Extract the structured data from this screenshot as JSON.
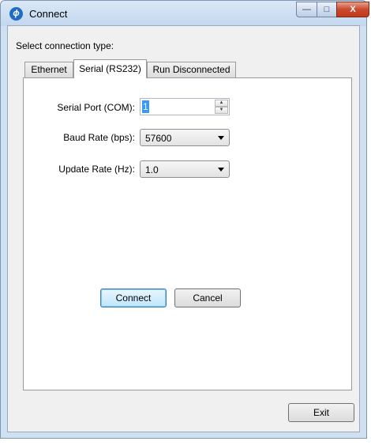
{
  "window": {
    "title": "Connect",
    "app_icon_glyph": "ϕ",
    "controls": {
      "minimize": "—",
      "maximize": "□",
      "close": "X"
    }
  },
  "dialog": {
    "prompt": "Select connection type:",
    "tabs": [
      {
        "label": "Ethernet",
        "selected": false
      },
      {
        "label": "Serial (RS232)",
        "selected": true
      },
      {
        "label": "Run Disconnected",
        "selected": false
      }
    ],
    "serial": {
      "serial_port": {
        "label": "Serial Port (COM):",
        "value": "1"
      },
      "baud_rate": {
        "label": "Baud Rate (bps):",
        "value": "57600"
      },
      "update_rate": {
        "label": "Update Rate (Hz):",
        "value": "1.0"
      },
      "connect_label": "Connect",
      "cancel_label": "Cancel"
    },
    "exit_label": "Exit"
  },
  "icons": {
    "app": "app-logo-icon",
    "spin_up": "▲",
    "spin_down": "▼"
  },
  "colors": {
    "title_bar": "#c2d7ee",
    "selection": "#3399ff",
    "close_button": "#c9492d",
    "default_button_border": "#3c7fb1"
  }
}
